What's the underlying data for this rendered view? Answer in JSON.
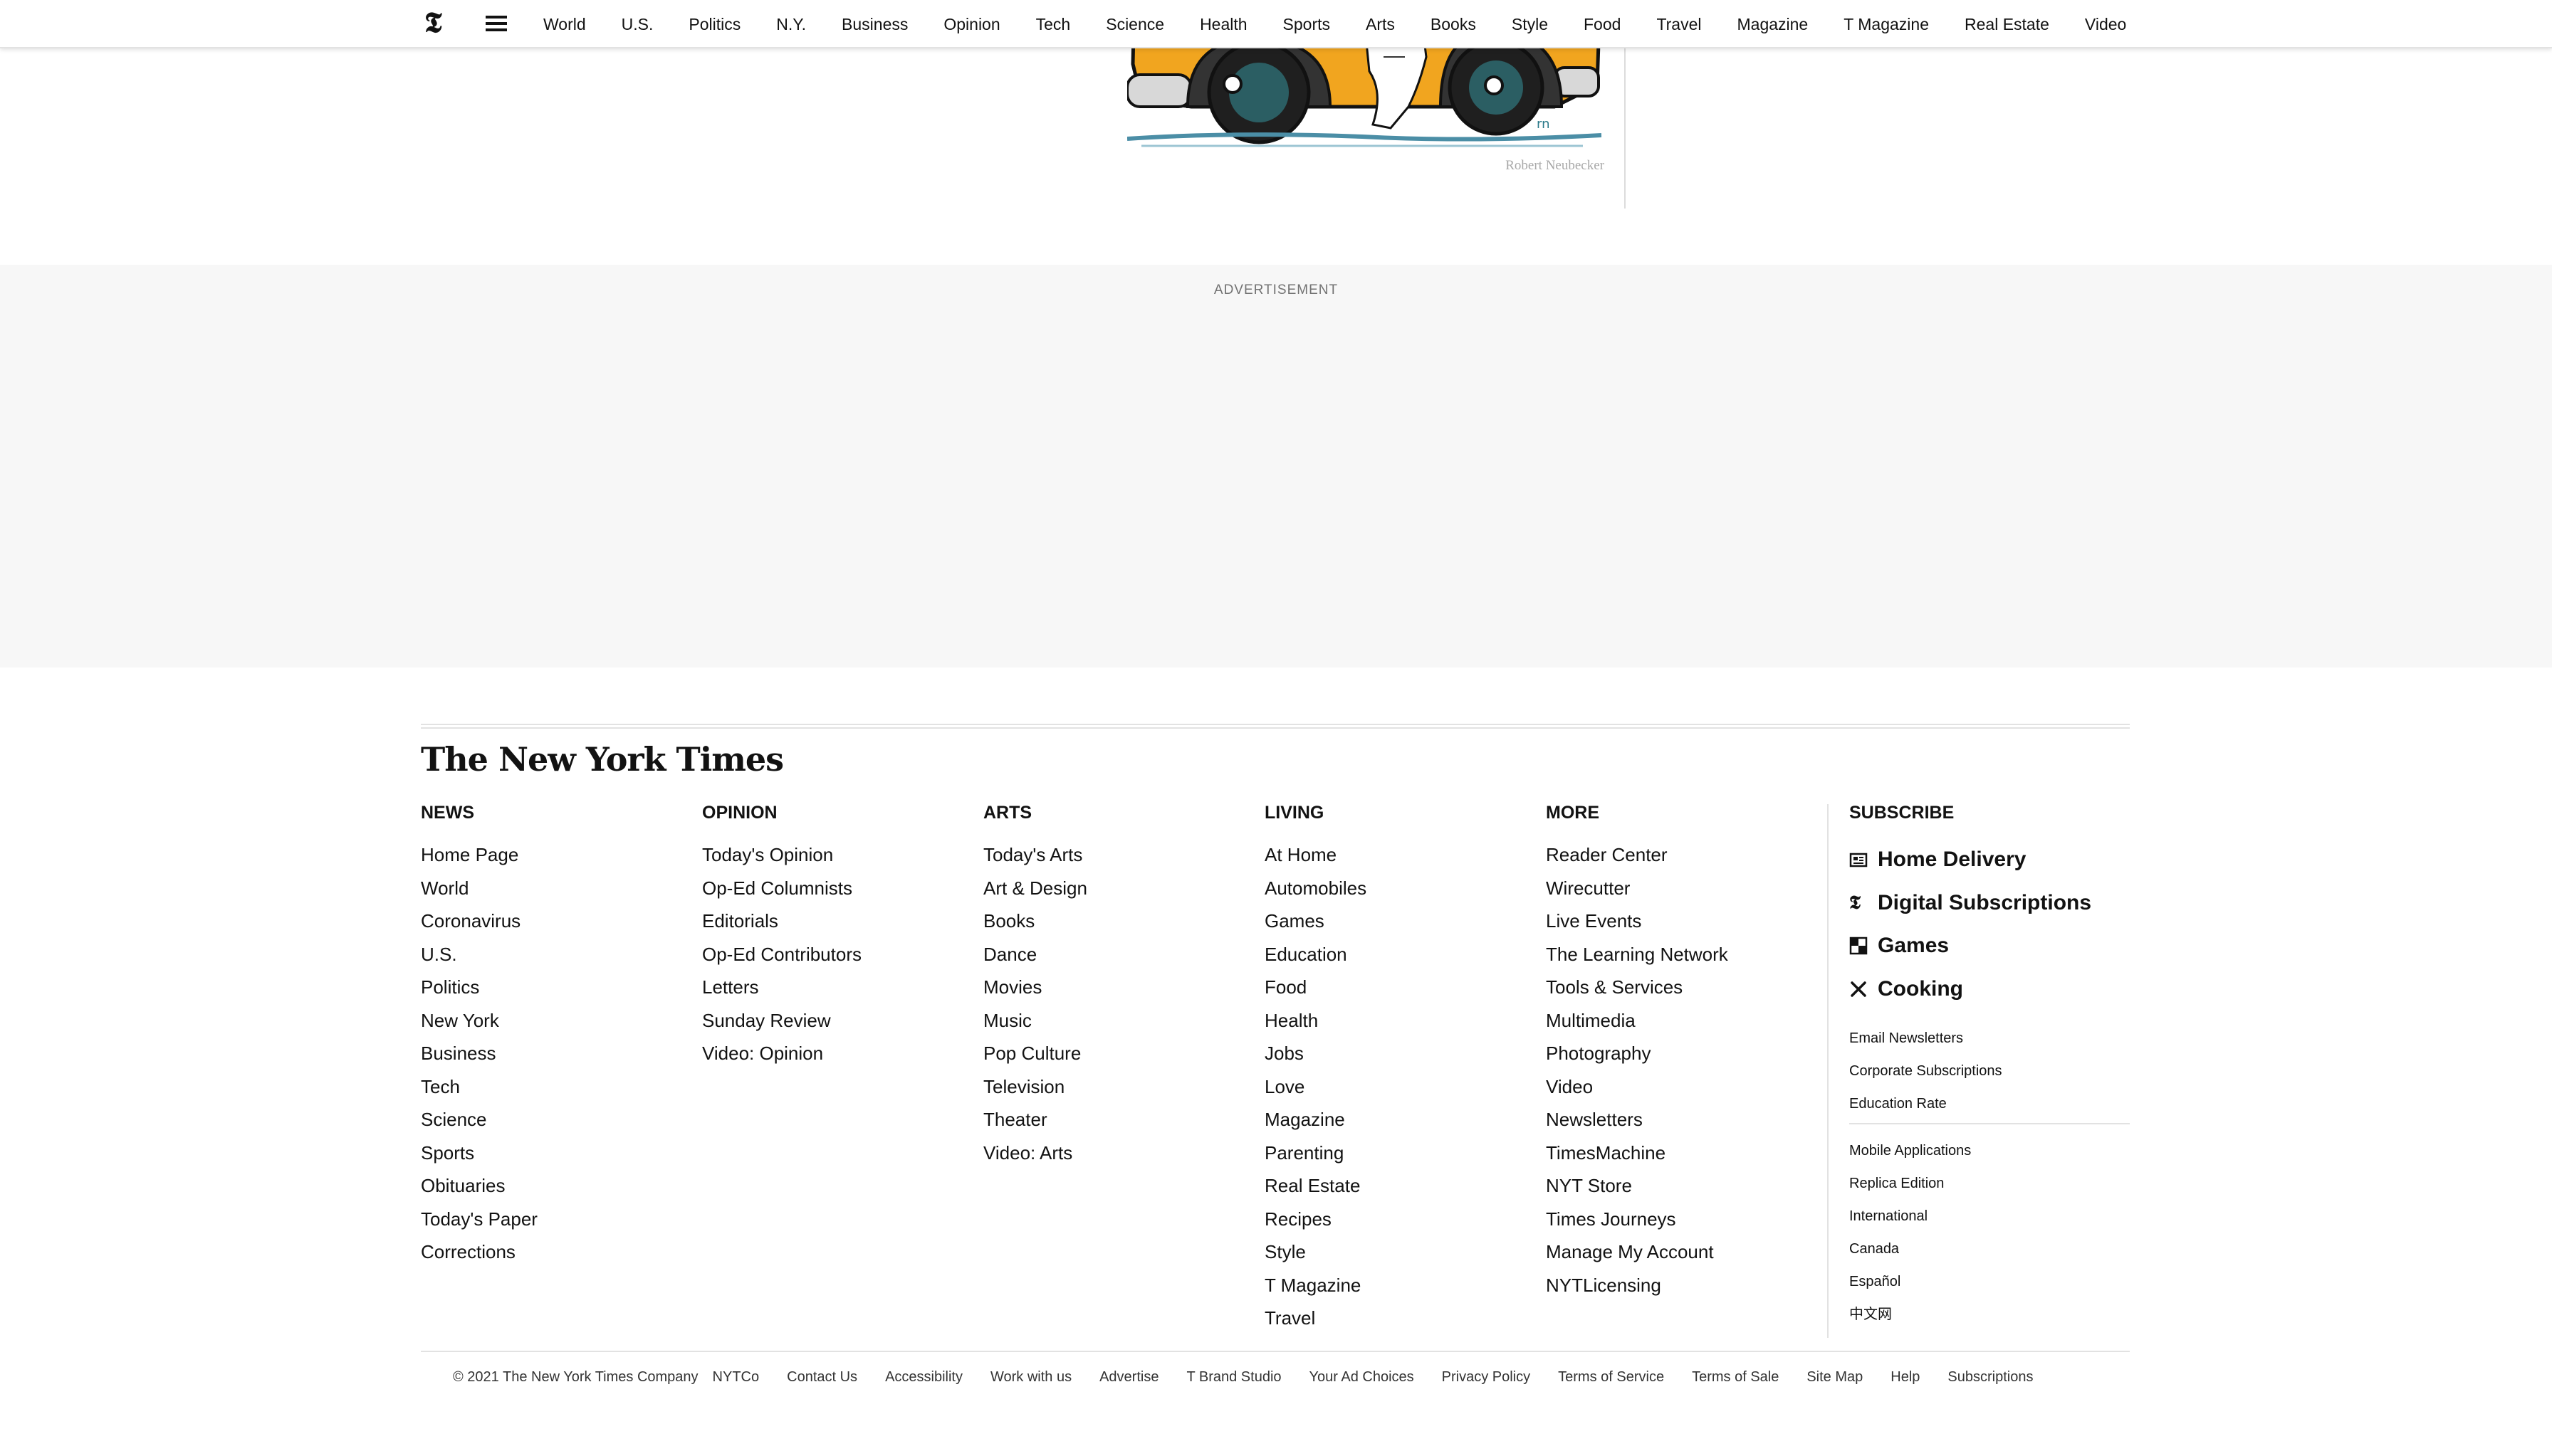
{
  "nav": {
    "items": [
      "World",
      "U.S.",
      "Politics",
      "N.Y.",
      "Business",
      "Opinion",
      "Tech",
      "Science",
      "Health",
      "Sports",
      "Arts",
      "Books",
      "Style",
      "Food",
      "Travel",
      "Magazine",
      "T Magazine",
      "Real Estate",
      "Video"
    ]
  },
  "article": {
    "image_credit": "Robert Neubecker"
  },
  "ad": {
    "label": "ADVERTISEMENT"
  },
  "footer": {
    "masthead": "The New York Times",
    "columns": [
      {
        "heading": "NEWS",
        "items": [
          "Home Page",
          "World",
          "Coronavirus",
          "U.S.",
          "Politics",
          "New York",
          "Business",
          "Tech",
          "Science",
          "Sports",
          "Obituaries",
          "Today's Paper",
          "Corrections"
        ]
      },
      {
        "heading": "OPINION",
        "items": [
          "Today's Opinion",
          "Op-Ed Columnists",
          "Editorials",
          "Op-Ed Contributors",
          "Letters",
          "Sunday Review",
          "Video: Opinion"
        ]
      },
      {
        "heading": "ARTS",
        "items": [
          "Today's Arts",
          "Art & Design",
          "Books",
          "Dance",
          "Movies",
          "Music",
          "Pop Culture",
          "Television",
          "Theater",
          "Video: Arts"
        ]
      },
      {
        "heading": "LIVING",
        "items": [
          "At Home",
          "Automobiles",
          "Games",
          "Education",
          "Food",
          "Health",
          "Jobs",
          "Love",
          "Magazine",
          "Parenting",
          "Real Estate",
          "Recipes",
          "Style",
          "T Magazine",
          "Travel"
        ]
      },
      {
        "heading": "MORE",
        "items": [
          "Reader Center",
          "Wirecutter",
          "Live Events",
          "The Learning Network",
          "Tools & Services",
          "Multimedia",
          "Photography",
          "Video",
          "Newsletters",
          "TimesMachine",
          "NYT Store",
          "Times Journeys",
          "Manage My Account",
          "NYTLicensing"
        ]
      }
    ],
    "subscribe": {
      "heading": "SUBSCRIBE",
      "main": [
        {
          "label": "Home Delivery",
          "icon": "newspaper-icon"
        },
        {
          "label": "Digital Subscriptions",
          "icon": "nyt-t-icon"
        },
        {
          "label": "Games",
          "icon": "crossword-icon"
        },
        {
          "label": "Cooking",
          "icon": "fork-knife-icon"
        }
      ],
      "small_a": [
        "Email Newsletters",
        "Corporate Subscriptions",
        "Education Rate"
      ],
      "small_b": [
        "Mobile Applications",
        "Replica Edition",
        "International",
        "Canada",
        "Español",
        "中文网"
      ]
    },
    "bottom_links": [
      "© 2021 The New York Times Company",
      "NYTCo",
      "Contact Us",
      "Accessibility",
      "Work with us",
      "Advertise",
      "T Brand Studio",
      "Your Ad Choices",
      "Privacy Policy",
      "Terms of Service",
      "Terms of Sale",
      "Site Map",
      "Help",
      "Subscriptions"
    ]
  }
}
